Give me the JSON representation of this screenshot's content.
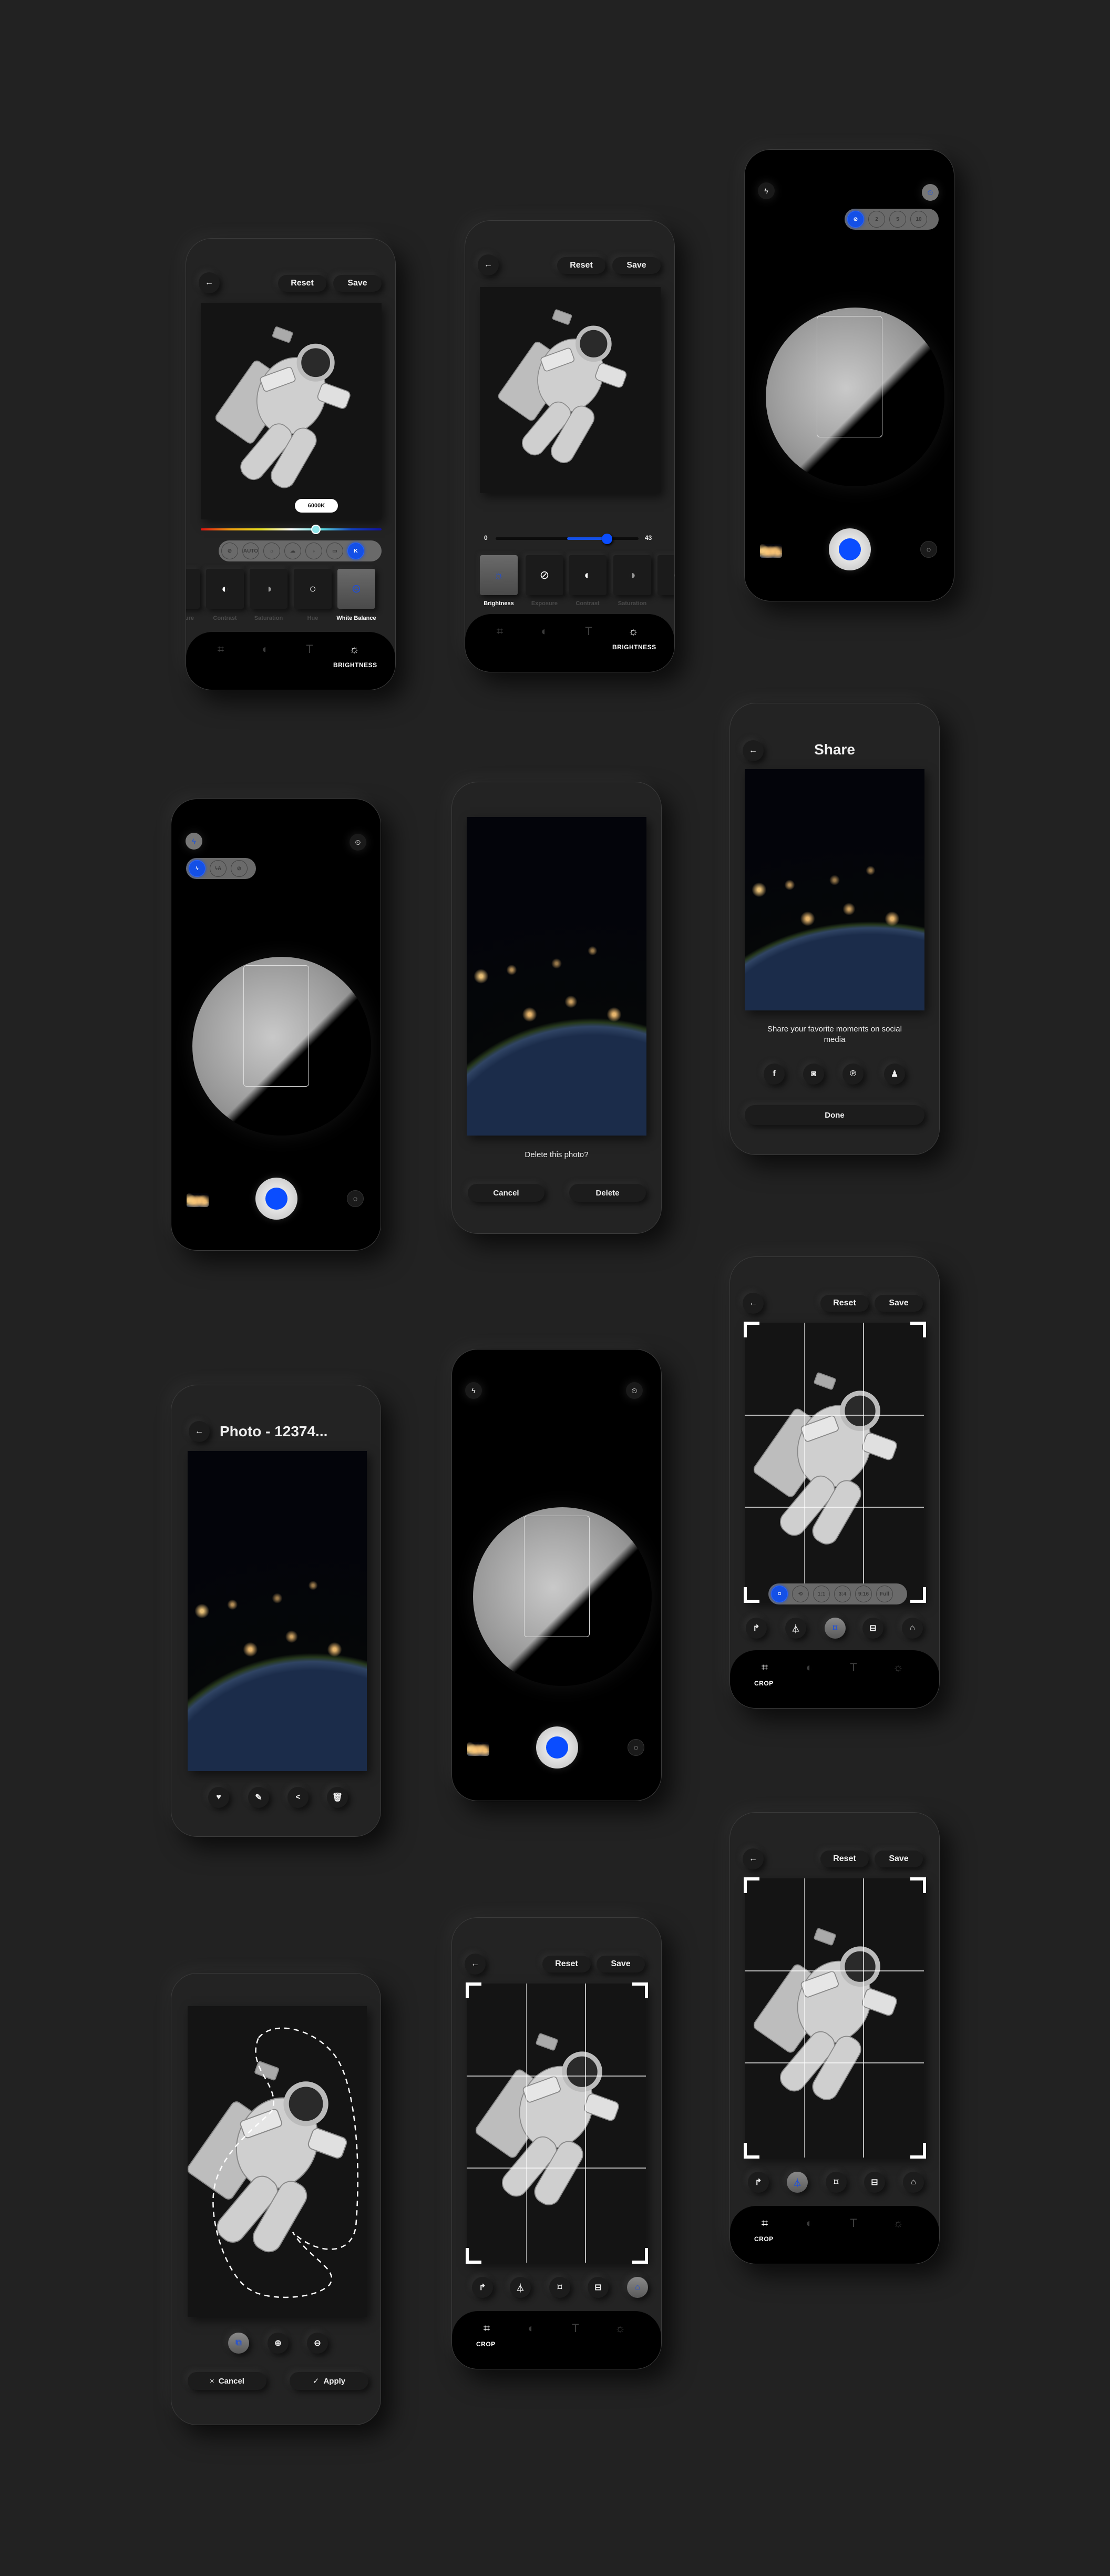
{
  "colors": {
    "background": "#222222",
    "phone": "#232323",
    "accent_blue": "#1450e6",
    "bar": "#000000"
  },
  "editor": {
    "reset": "Reset",
    "save": "Save",
    "back_icon": "arrow-left-icon"
  },
  "nav": {
    "crop_label": "CROP",
    "brightness_label": "BRIGHTNESS",
    "items": [
      "crop-icon",
      "contrast-icon",
      "text-icon",
      "brightness-icon"
    ]
  },
  "white_balance": {
    "tooltip": "6000K",
    "slider_position": 0.63,
    "options": [
      {
        "label": "",
        "icon": "no-wb-icon"
      },
      {
        "label": "AUTO",
        "icon": "auto-icon"
      },
      {
        "label": "",
        "icon": "sun-icon"
      },
      {
        "label": "",
        "icon": "cloud-icon"
      },
      {
        "label": "",
        "icon": "bulb-icon"
      },
      {
        "label": "",
        "icon": "fluorescent-icon"
      },
      {
        "label": "K",
        "icon": "kelvin-icon",
        "active": true
      }
    ],
    "tools": [
      "Exposure",
      "Contrast",
      "Saturation",
      "Hue",
      "White Balance"
    ],
    "active_tool": "White Balance"
  },
  "brightness": {
    "min_label": "0",
    "value_label": "43",
    "slider_position": 0.78,
    "tools": [
      "Brightness",
      "Exposure",
      "Contrast",
      "Saturation"
    ],
    "active_tool": "Brightness"
  },
  "camera": {
    "timer_options": [
      {
        "label": "",
        "icon": "timer-off-icon",
        "active": true
      },
      {
        "label": "2"
      },
      {
        "label": "5"
      },
      {
        "label": "10"
      }
    ],
    "flash_options": [
      {
        "icon": "flash-on-icon",
        "active": true
      },
      {
        "icon": "flash-auto-icon"
      },
      {
        "icon": "flash-off-icon"
      }
    ]
  },
  "delete_dialog": {
    "question": "Delete this photo?",
    "cancel": "Cancel",
    "delete": "Delete"
  },
  "share": {
    "title": "Share",
    "message": "Share your favorite moments on social media",
    "networks": [
      "facebook-icon",
      "instagram-icon",
      "pinterest-icon",
      "snapchat-icon"
    ],
    "done": "Done"
  },
  "photo": {
    "title": "Photo - 12374...",
    "actions": [
      "heart-icon",
      "edit-image-icon",
      "share-icon",
      "trash-icon"
    ]
  },
  "crop": {
    "ratios": [
      "1:1",
      "3:4",
      "9:16",
      "Full"
    ],
    "tools": [
      "rotate-icon",
      "flip-icon",
      "free-crop-icon",
      "fit-icon",
      "background-icon"
    ]
  },
  "lasso": {
    "cancel": "Cancel",
    "apply": "Apply",
    "cancel_icon": "×",
    "apply_icon": "✓"
  }
}
